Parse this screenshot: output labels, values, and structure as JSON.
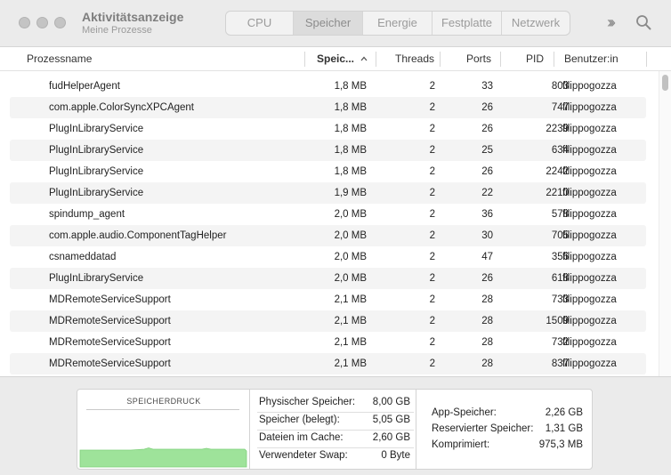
{
  "window": {
    "title": "Aktivitätsanzeige",
    "subtitle": "Meine Prozesse",
    "tabs": [
      "CPU",
      "Speicher",
      "Energie",
      "Festplatte",
      "Netzwerk"
    ],
    "active_tab": "Speicher"
  },
  "columns": {
    "name": "Prozessname",
    "memory": "Speic...",
    "threads": "Threads",
    "ports": "Ports",
    "pid": "PID",
    "user": "Benutzer:in"
  },
  "processes": [
    {
      "name": "fudHelperAgent",
      "memory": "1,8 MB",
      "threads": "2",
      "ports": "33",
      "pid": "803",
      "user": "filippogozza"
    },
    {
      "name": "com.apple.ColorSyncXPCAgent",
      "memory": "1,8 MB",
      "threads": "2",
      "ports": "26",
      "pid": "747",
      "user": "filippogozza"
    },
    {
      "name": "PlugInLibraryService",
      "memory": "1,8 MB",
      "threads": "2",
      "ports": "26",
      "pid": "2239",
      "user": "filippogozza"
    },
    {
      "name": "PlugInLibraryService",
      "memory": "1,8 MB",
      "threads": "2",
      "ports": "25",
      "pid": "634",
      "user": "filippogozza"
    },
    {
      "name": "PlugInLibraryService",
      "memory": "1,8 MB",
      "threads": "2",
      "ports": "26",
      "pid": "2242",
      "user": "filippogozza"
    },
    {
      "name": "PlugInLibraryService",
      "memory": "1,9 MB",
      "threads": "2",
      "ports": "22",
      "pid": "2210",
      "user": "filippogozza"
    },
    {
      "name": "spindump_agent",
      "memory": "2,0 MB",
      "threads": "2",
      "ports": "36",
      "pid": "578",
      "user": "filippogozza"
    },
    {
      "name": "com.apple.audio.ComponentTagHelper",
      "memory": "2,0 MB",
      "threads": "2",
      "ports": "30",
      "pid": "705",
      "user": "filippogozza"
    },
    {
      "name": "csnameddatad",
      "memory": "2,0 MB",
      "threads": "2",
      "ports": "47",
      "pid": "356",
      "user": "filippogozza"
    },
    {
      "name": "PlugInLibraryService",
      "memory": "2,0 MB",
      "threads": "2",
      "ports": "26",
      "pid": "618",
      "user": "filippogozza"
    },
    {
      "name": "MDRemoteServiceSupport",
      "memory": "2,1 MB",
      "threads": "2",
      "ports": "28",
      "pid": "733",
      "user": "filippogozza"
    },
    {
      "name": "MDRemoteServiceSupport",
      "memory": "2,1 MB",
      "threads": "2",
      "ports": "28",
      "pid": "1509",
      "user": "filippogozza"
    },
    {
      "name": "MDRemoteServiceSupport",
      "memory": "2,1 MB",
      "threads": "2",
      "ports": "28",
      "pid": "732",
      "user": "filippogozza"
    },
    {
      "name": "MDRemoteServiceSupport",
      "memory": "2,1 MB",
      "threads": "2",
      "ports": "28",
      "pid": "837",
      "user": "filippogozza"
    }
  ],
  "memory_pressure": {
    "title": "SPEICHERDRUCK",
    "color": "#9ee39a"
  },
  "stats": [
    {
      "label": "Physischer Speicher:",
      "value": "8,00 GB"
    },
    {
      "label": "Speicher (belegt):",
      "value": "5,05 GB"
    },
    {
      "label": "Dateien im Cache:",
      "value": "2,60 GB"
    },
    {
      "label": "Verwendeter Swap:",
      "value": "0 Byte"
    }
  ],
  "stats2": [
    {
      "label": "App-Speicher:",
      "value": "2,26 GB"
    },
    {
      "label": "Reservierter Speicher:",
      "value": "1,31 GB"
    },
    {
      "label": "Komprimiert:",
      "value": "975,3 MB"
    }
  ]
}
